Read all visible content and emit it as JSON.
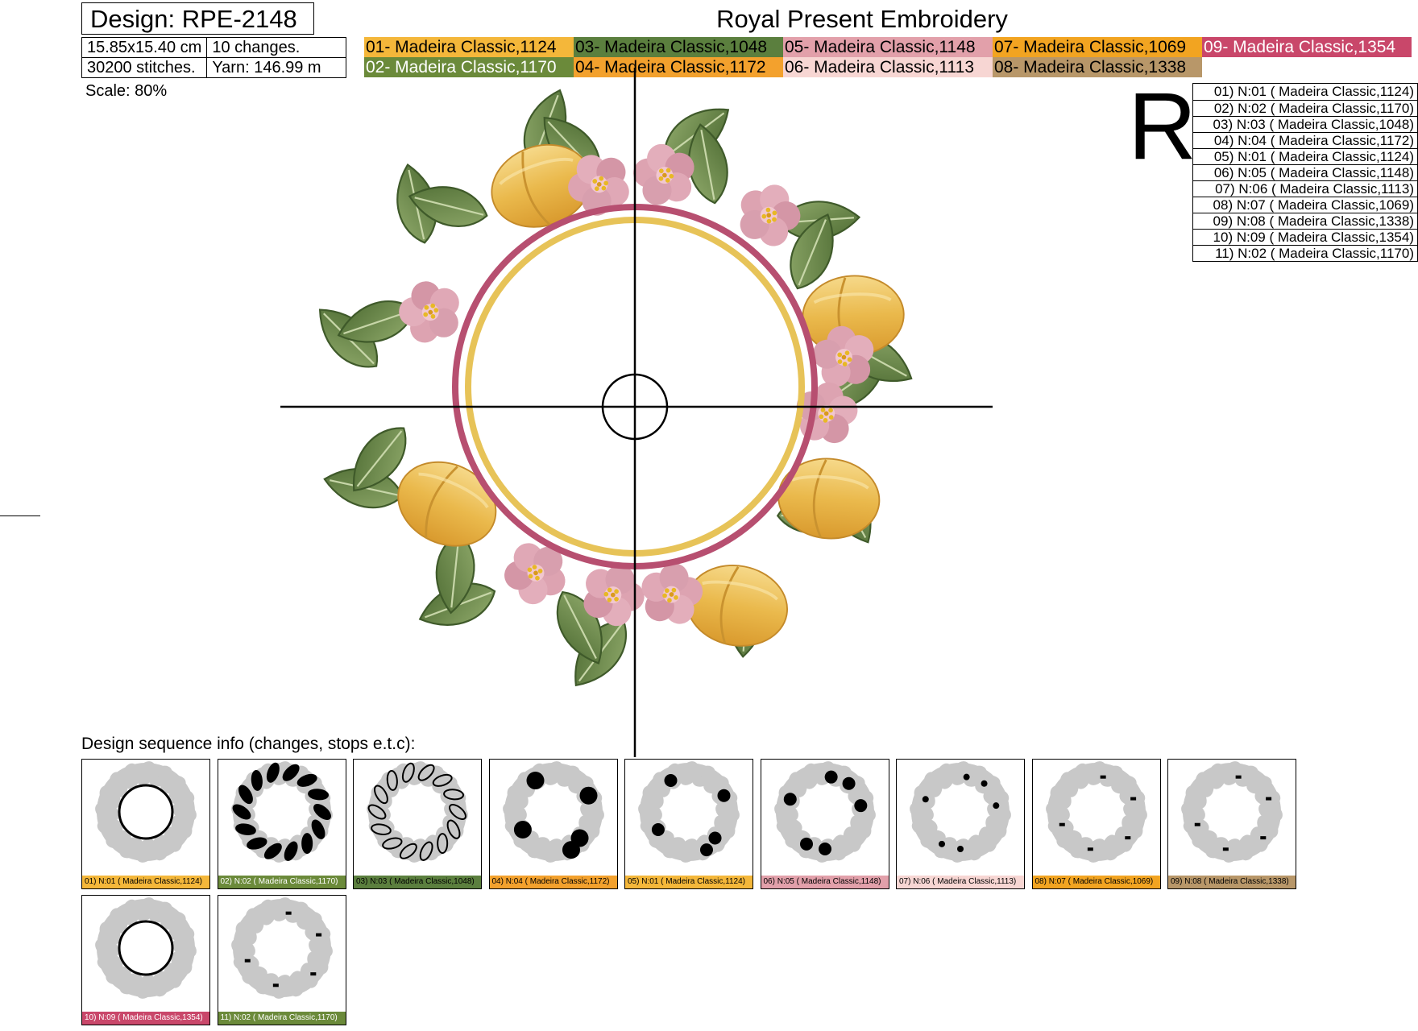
{
  "header": {
    "design_label": "Design: RPE-2148",
    "title": "Royal Present Embroidery",
    "size": "15.85x15.40 cm",
    "changes": "10 changes.",
    "stitches": "30200 stitches.",
    "yarn": "Yarn: 146.99 m",
    "scale": "Scale: 80%"
  },
  "palette": [
    {
      "label": "01- Madeira Classic,1124",
      "color": "#f4b73a",
      "text_color": "#000000"
    },
    {
      "label": "03- Madeira Classic,1048",
      "color": "#5b7f3e",
      "text_color": "#000000"
    },
    {
      "label": "05- Madeira Classic,1148",
      "color": "#e2a0aa",
      "text_color": "#000000"
    },
    {
      "label": "07- Madeira Classic,1069",
      "color": "#f2a421",
      "text_color": "#000000"
    },
    {
      "label": "09- Madeira Classic,1354",
      "color": "#c9476a",
      "text_color": "#ffffff"
    },
    {
      "label": "02- Madeira Classic,1170",
      "color": "#6b8a3a",
      "text_color": "#ffffff"
    },
    {
      "label": "04- Madeira Classic,1172",
      "color": "#f3a12d",
      "text_color": "#000000"
    },
    {
      "label": "06- Madeira Classic,1113",
      "color": "#f7d6d3",
      "text_color": "#000000"
    },
    {
      "label": "08- Madeira Classic,1338",
      "color": "#b89769",
      "text_color": "#000000"
    },
    {
      "label": "",
      "color": "#ffffff",
      "text_color": "#000000"
    }
  ],
  "monogram_letter": "R",
  "sequence_list": [
    "01) N:01 ( Madeira Classic,1124)",
    "02) N:02 ( Madeira Classic,1170)",
    "03) N:03 ( Madeira Classic,1048)",
    "04) N:04 ( Madeira Classic,1172)",
    "05) N:01 ( Madeira Classic,1124)",
    "06) N:05 ( Madeira Classic,1148)",
    "07) N:06 ( Madeira Classic,1113)",
    "08) N:07 ( Madeira Classic,1069)",
    "09) N:08 ( Madeira Classic,1338)",
    "10) N:09 ( Madeira Classic,1354)",
    "11) N:02 ( Madeira Classic,1170)"
  ],
  "sequence_title": "Design sequence info (changes, stops e.t.c):",
  "thumbnails": [
    {
      "caption": "01) N:01 ( Madeira Classic,1124)",
      "color": "#f4b73a",
      "text_color": "#000000",
      "highlight": "ring"
    },
    {
      "caption": "02) N:02 ( Madeira Classic,1170)",
      "color": "#6b8a3a",
      "text_color": "#ffffff",
      "highlight": "leaves"
    },
    {
      "caption": "03) N:03 ( Madeira Classic,1048)",
      "color": "#5b7f3e",
      "text_color": "#000000",
      "highlight": "outline"
    },
    {
      "caption": "04) N:04 ( Madeira Classic,1172)",
      "color": "#f3a12d",
      "text_color": "#000000",
      "highlight": "fruits"
    },
    {
      "caption": "05) N:01 ( Madeira Classic,1124)",
      "color": "#f4b73a",
      "text_color": "#000000",
      "highlight": "fruitdetail"
    },
    {
      "caption": "06) N:05 ( Madeira Classic,1148)",
      "color": "#e2a0aa",
      "text_color": "#000000",
      "highlight": "flowers"
    },
    {
      "caption": "07) N:06 ( Madeira Classic,1113)",
      "color": "#f7d6d3",
      "text_color": "#000000",
      "highlight": "petals"
    },
    {
      "caption": "08) N:07 ( Madeira Classic,1069)",
      "color": "#f2a421",
      "text_color": "#000000",
      "highlight": "centers"
    },
    {
      "caption": "09) N:08 ( Madeira Classic,1338)",
      "color": "#b89769",
      "text_color": "#000000",
      "highlight": "stems"
    },
    {
      "caption": "10) N:09 ( Madeira Classic,1354)",
      "color": "#c9476a",
      "text_color": "#ffffff",
      "highlight": "ring"
    },
    {
      "caption": "11) N:02 ( Madeira Classic,1170)",
      "color": "#6b8a3a",
      "text_color": "#ffffff",
      "highlight": "bits"
    }
  ]
}
